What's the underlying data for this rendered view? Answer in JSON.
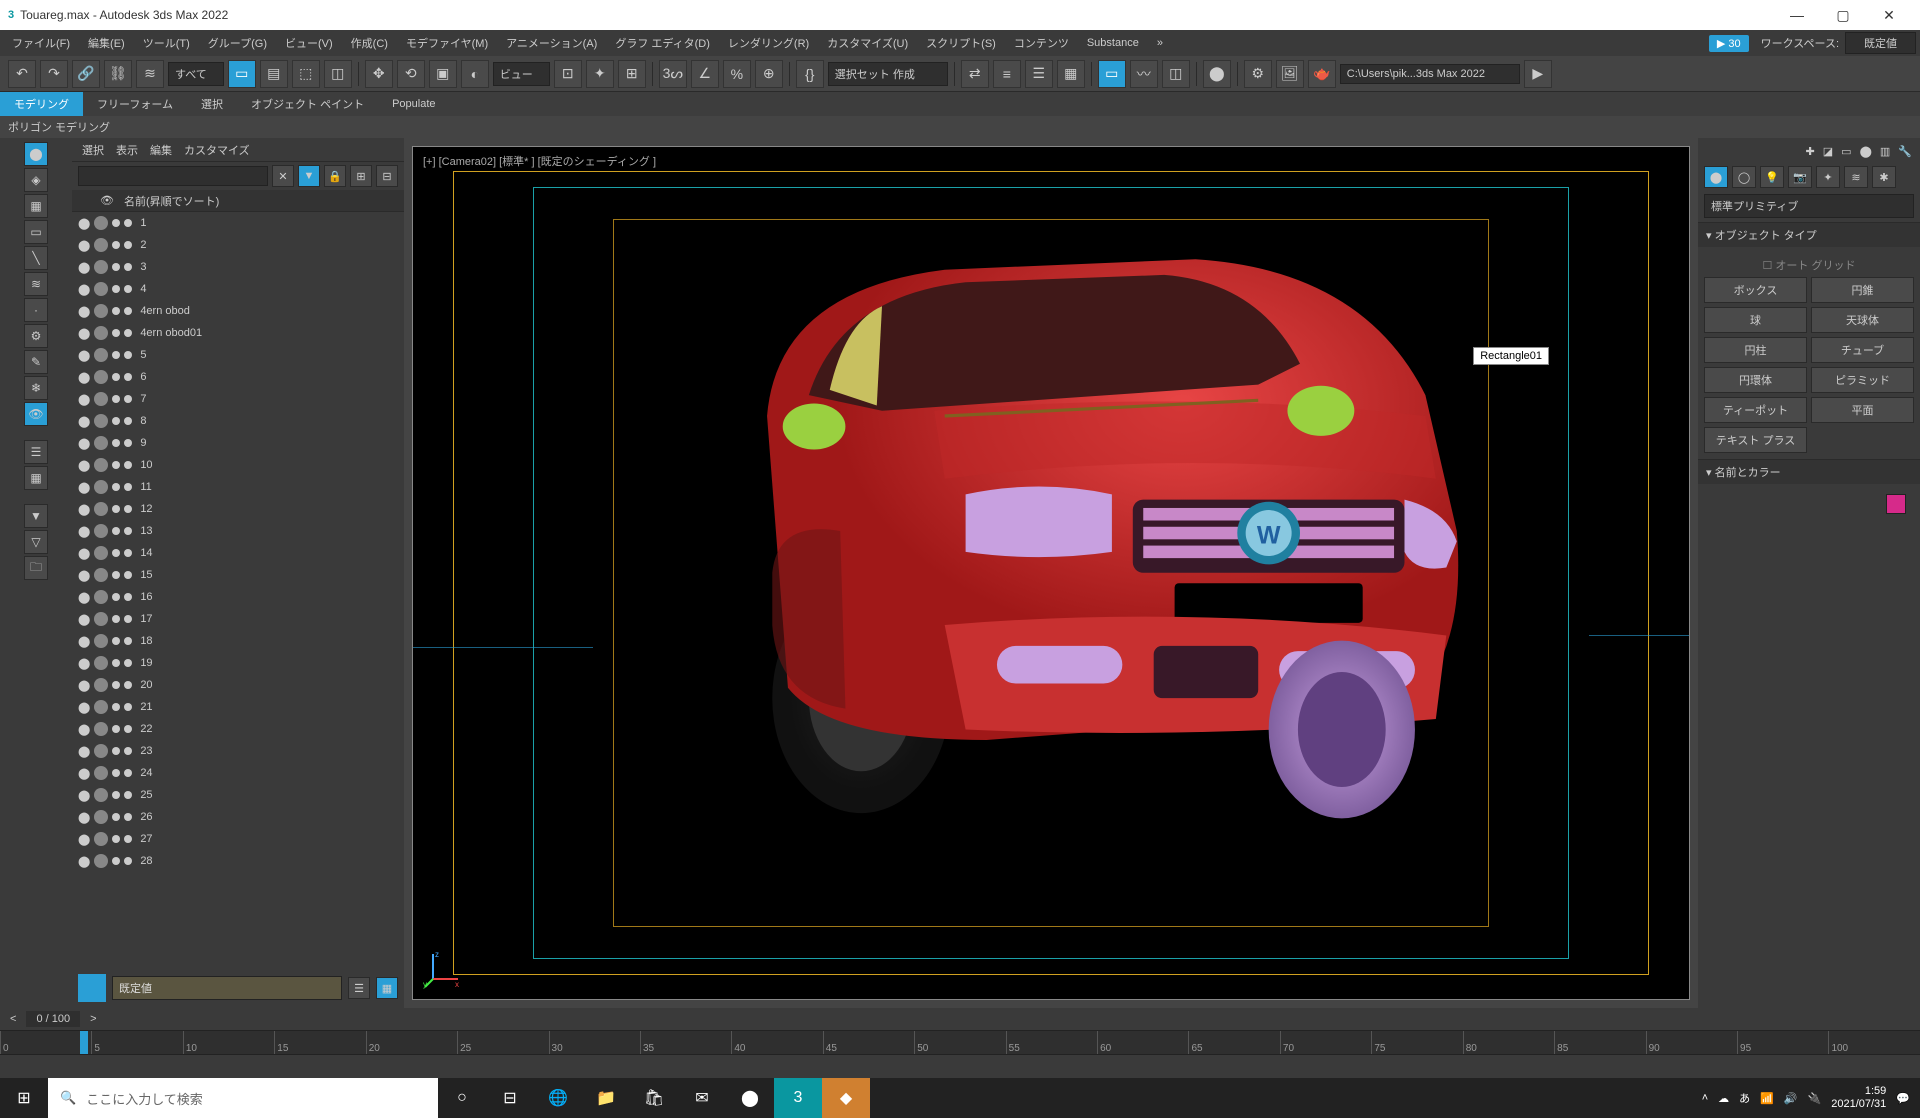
{
  "title": "Touareg.max - Autodesk 3ds Max 2022",
  "menus": [
    "ファイル(F)",
    "編集(E)",
    "ツール(T)",
    "グループ(G)",
    "ビュー(V)",
    "作成(C)",
    "モデファイヤ(M)",
    "アニメーション(A)",
    "グラフ エディタ(D)",
    "レンダリング(R)",
    "カスタマイズ(U)",
    "スクリプト(S)",
    "コンテンツ",
    "Substance"
  ],
  "fps": "30",
  "workspace": {
    "label": "ワークスペース:",
    "value": "既定値"
  },
  "toolbar": {
    "all": "すべて",
    "viewlabel": "ビュー",
    "selset": "選択セット 作成",
    "path": "C:\\Users\\pik...3ds Max 2022"
  },
  "ribbon": {
    "tabs": [
      "モデリング",
      "フリーフォーム",
      "選択",
      "オブジェクト ペイント",
      "Populate"
    ],
    "sub": "ポリゴン モデリング"
  },
  "scene": {
    "tabs": [
      "選択",
      "表示",
      "編集",
      "カスタマイズ"
    ],
    "header": "名前(昇順でソート)",
    "items": [
      "1",
      "2",
      "3",
      "4",
      "4ern obod",
      "4ern obod01",
      "5",
      "6",
      "7",
      "8",
      "9",
      "10",
      "11",
      "12",
      "13",
      "14",
      "15",
      "16",
      "17",
      "18",
      "19",
      "20",
      "21",
      "22",
      "23",
      "24",
      "25",
      "26",
      "27",
      "28"
    ],
    "preset": "既定値"
  },
  "viewport": {
    "label": "[+]  [Camera02]  [標準* ]  [既定のシェーディング ]",
    "tooltip": "Rectangle01"
  },
  "cmdpanel": {
    "dropdown": "標準プリミティブ",
    "rollout1": "オブジェクト タイプ",
    "autogrid": "オート グリッド",
    "prims": [
      "ボックス",
      "円錐",
      "球",
      "天球体",
      "円柱",
      "チューブ",
      "円環体",
      "ピラミッド",
      "ティーポット",
      "平面",
      "テキスト プラス"
    ],
    "rollout2": "名前とカラー"
  },
  "timeline": {
    "frame": "0 / 100",
    "ticks": [
      "0",
      "5",
      "10",
      "15",
      "20",
      "25",
      "30",
      "35",
      "40",
      "45",
      "50",
      "55",
      "60",
      "65",
      "70",
      "75",
      "80",
      "85",
      "90",
      "95",
      "100"
    ]
  },
  "taskbar": {
    "search": "ここに入力して検索",
    "time": "1:59",
    "date": "2021/07/31"
  }
}
